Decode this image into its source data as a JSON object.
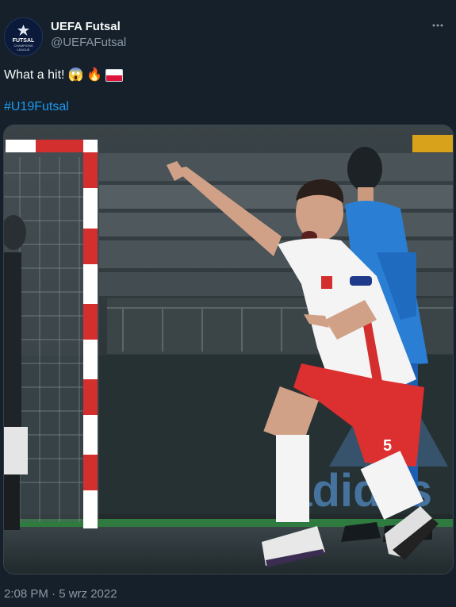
{
  "author": {
    "name": "UEFA Futsal",
    "handle": "@UEFAFutsal",
    "avatar_text": [
      "FUTSAL",
      "CHAMPIONS",
      "LEAGUE"
    ]
  },
  "tweet": {
    "text": "What a hit!",
    "emojis": [
      "😱",
      "🔥"
    ],
    "flag": "poland-flag",
    "hashtag": "#U19Futsal",
    "timestamp": "2:08 PM · 5 wrz 2022"
  },
  "media": {
    "jersey_number": "5",
    "ad_text": "adidas"
  },
  "colors": {
    "background": "#15202b",
    "text": "#f7f9f9",
    "secondary": "#8b98a5",
    "link": "#1d9bf0",
    "border": "#38444d"
  },
  "icons": {
    "more": "more-options-icon"
  }
}
